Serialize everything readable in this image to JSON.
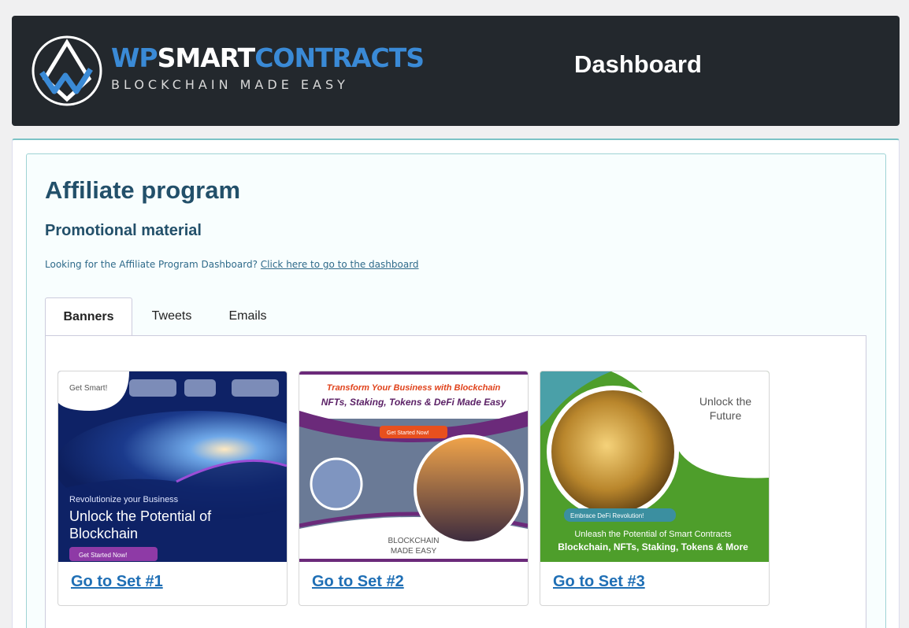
{
  "header": {
    "brand_wp": "WP",
    "brand_smart": "SMART",
    "brand_contracts": "CONTRACTS",
    "brand_tagline": "BLOCKCHAIN MADE EASY",
    "title": "Dashboard"
  },
  "page": {
    "title": "Affiliate program",
    "subtitle": "Promotional material",
    "note_text": "Looking for the Affiliate Program Dashboard?",
    "note_link": "Click here to go to the dashboard"
  },
  "tabs": [
    {
      "label": "Banners",
      "active": true
    },
    {
      "label": "Tweets",
      "active": false
    },
    {
      "label": "Emails",
      "active": false
    }
  ],
  "banners": [
    {
      "link": "Go to Set #1",
      "badge": "Get Smart!",
      "kicker": "Revolutionize your Business",
      "headline_1": "Unlock the Potential of",
      "headline_2": "Blockchain",
      "cta": "Get Started Now!"
    },
    {
      "link": "Go to Set #2",
      "headline_1": "Transform Your Business with Blockchain",
      "headline_2": "NFTs, Staking, Tokens & DeFi Made Easy",
      "cta": "Get Started Now!",
      "footer_1": "BLOCKCHAIN",
      "footer_2": "MADE EASY"
    },
    {
      "link": "Go to Set #3",
      "corner_1": "Unlock the",
      "corner_2": "Future",
      "cta": "Embrace DeFi Revolution!",
      "line_1": "Unleash the Potential of Smart Contracts",
      "line_2": "Blockchain, NFTs, Staking, Tokens & More"
    }
  ],
  "colors": {
    "header_bg": "#23282d",
    "brand_blue": "#3a8ad6",
    "heading": "#23506a",
    "link": "#1f6fb5",
    "accent_border": "#7cc3c6"
  }
}
